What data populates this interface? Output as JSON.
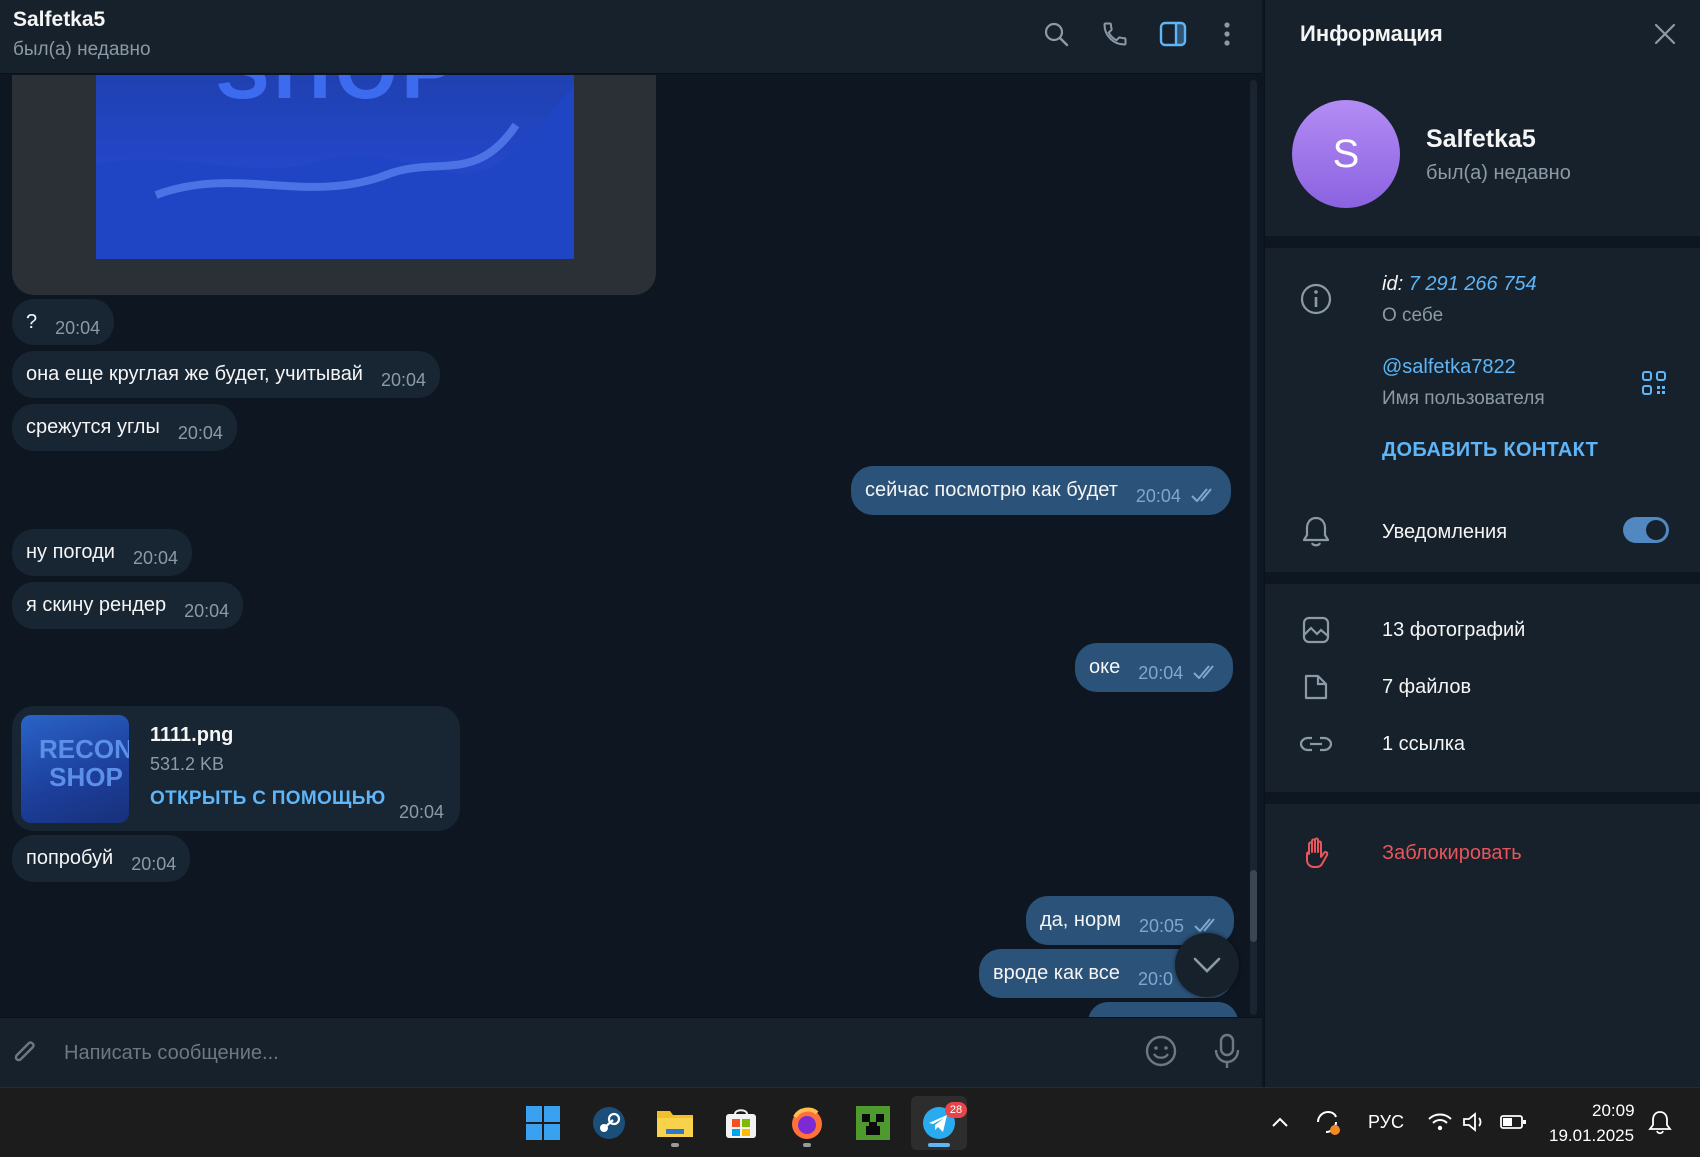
{
  "chat": {
    "title": "Salfetka5",
    "status": "был(а) недавно"
  },
  "messages": [
    {
      "dir": "in",
      "text": "?",
      "time": "20:04"
    },
    {
      "dir": "in",
      "text": "она еще круглая же будет, учитывай",
      "time": "20:04"
    },
    {
      "dir": "in",
      "text": "срежутся углы",
      "time": "20:04"
    },
    {
      "dir": "out",
      "text": "сейчас посмотрю как будет",
      "time": "20:04"
    },
    {
      "dir": "in",
      "text": "ну погоди",
      "time": "20:04"
    },
    {
      "dir": "in",
      "text": "я скину рендер",
      "time": "20:04"
    },
    {
      "dir": "out",
      "text": "оке",
      "time": "20:04"
    },
    {
      "dir": "in",
      "text": "попробуй",
      "time": "20:04"
    },
    {
      "dir": "out",
      "text": "да, норм",
      "time": "20:05"
    },
    {
      "dir": "out",
      "text": "вроде как все",
      "time": "20:0"
    }
  ],
  "image_preview_text": "SHOP",
  "file": {
    "name": "1111.png",
    "size": "531.2 KB",
    "action": "ОТКРЫТЬ С ПОМОЩЬЮ",
    "time": "20:04",
    "thumb_line1": "RECON",
    "thumb_line2": "SHOP"
  },
  "composer": {
    "placeholder": "Написать сообщение..."
  },
  "info": {
    "title": "Информация",
    "avatar_letter": "S",
    "name": "Salfetka5",
    "status": "был(а) недавно",
    "id_label": "id:",
    "id_value": "7 291 266 754",
    "bio_label": "О себе",
    "username": "@salfetka7822",
    "username_label": "Имя пользователя",
    "add_contact": "ДОБАВИТЬ КОНТАКТ",
    "notifications": "Уведомления",
    "notifications_on": true,
    "photos": "13 фотографий",
    "files": "7 файлов",
    "links": "1 ссылка",
    "block": "Заблокировать"
  },
  "taskbar": {
    "telegram_badge": "28",
    "language": "РУС",
    "time": "20:09",
    "date": "19.01.2025"
  },
  "colors": {
    "bg": "#0e1621",
    "panel": "#17212b",
    "incoming": "#182533",
    "outgoing": "#2b5278",
    "accent": "#5eb5f7",
    "danger": "#e8555a"
  }
}
